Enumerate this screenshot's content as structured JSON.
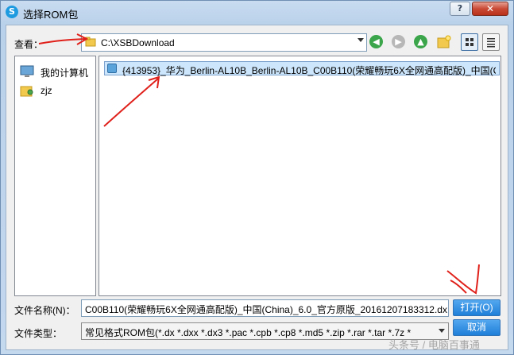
{
  "window": {
    "title": "选择ROM包",
    "help_label": "?",
    "close_label": "✕",
    "app_icon_letter": "S"
  },
  "toolbar": {
    "lookin_label": "查看：",
    "path": "C:\\XSBDownload",
    "nav_icons": [
      "back-icon",
      "forward-icon",
      "up-folder-icon",
      "new-folder-icon",
      "view-details-icon",
      "view-list-icon"
    ]
  },
  "sidebar": {
    "items": [
      {
        "label": "我的计算机",
        "icon": "computer-icon"
      },
      {
        "label": "zjz",
        "icon": "user-folder-icon"
      }
    ]
  },
  "files": [
    {
      "name": "{413953}_华为_Berlin-AL10B_Berlin-AL10B_C00B110(荣耀畅玩6X全网通高配版)_中国(C",
      "selected": true
    }
  ],
  "form": {
    "filename_label": "文件名称(N)：",
    "filename_value": "C00B110(荣耀畅玩6X全网通高配版)_中国(China)_6.0_官方原版_20161207183312.dx",
    "filetype_label": "文件类型：",
    "filetype_value": "常见格式ROM包(*.dx *.dxx *.dx3 *.pac *.cpb *.cp8 *.md5 *.zip *.rar *.tar *.7z *",
    "open_label": "打开(O)",
    "cancel_label": "取消"
  },
  "watermark": "头条号 / 电脑百事通",
  "colors": {
    "accent": "#1f7fd8",
    "selection": "#cde6fb",
    "annotation": "#e0201a"
  }
}
